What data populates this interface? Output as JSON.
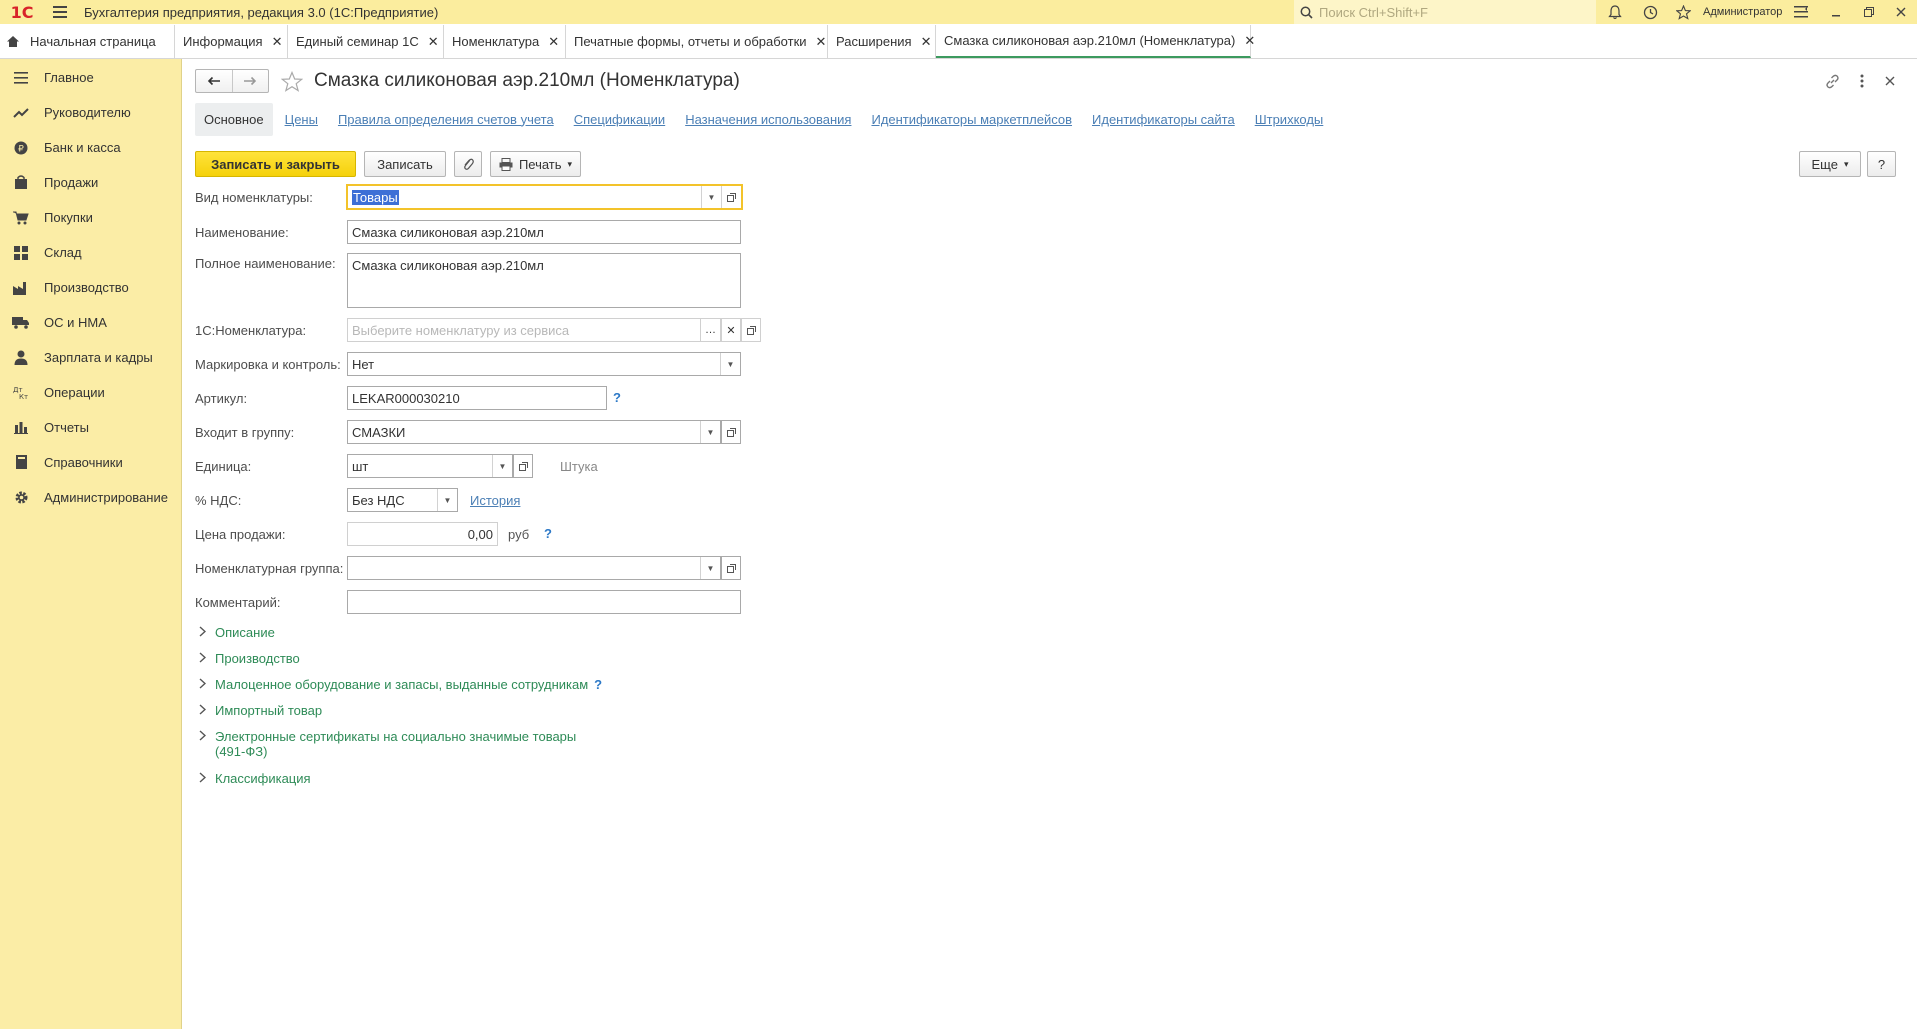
{
  "app": {
    "logo": "1С",
    "title": "Бухгалтерия предприятия, редакция 3.0  (1С:Предприятие)",
    "search_placeholder": "Поиск Ctrl+Shift+F",
    "user": "Администратор"
  },
  "tabs": [
    {
      "label": "Начальная страница"
    },
    {
      "label": "Информация"
    },
    {
      "label": "Единый семинар 1С"
    },
    {
      "label": "Номенклатура"
    },
    {
      "label": "Печатные формы, отчеты и обработки"
    },
    {
      "label": "Расширения"
    },
    {
      "label": "Смазка силиконовая аэр.210мл (Номенклатура)"
    }
  ],
  "sidebar": {
    "items": [
      {
        "label": "Главное",
        "icon": "menu-icon"
      },
      {
        "label": "Руководителю",
        "icon": "trend-icon"
      },
      {
        "label": "Банк и касса",
        "icon": "coin-icon"
      },
      {
        "label": "Продажи",
        "icon": "bag-icon"
      },
      {
        "label": "Покупки",
        "icon": "cart-icon"
      },
      {
        "label": "Склад",
        "icon": "grid-icon"
      },
      {
        "label": "Производство",
        "icon": "factory-icon"
      },
      {
        "label": "ОС и НМА",
        "icon": "truck-icon"
      },
      {
        "label": "Зарплата и кадры",
        "icon": "person-icon"
      },
      {
        "label": "Операции",
        "icon": "dtkt-icon"
      },
      {
        "label": "Отчеты",
        "icon": "bar-chart-icon"
      },
      {
        "label": "Справочники",
        "icon": "book-icon"
      },
      {
        "label": "Администрирование",
        "icon": "gear-icon"
      }
    ]
  },
  "form": {
    "title": "Смазка силиконовая аэр.210мл (Номенклатура)",
    "subtabs": [
      {
        "label": "Основное"
      },
      {
        "label": "Цены"
      },
      {
        "label": "Правила определения счетов учета"
      },
      {
        "label": "Спецификации"
      },
      {
        "label": "Назначения использования"
      },
      {
        "label": "Идентификаторы маркетплейсов"
      },
      {
        "label": "Идентификаторы сайта"
      },
      {
        "label": "Штрихкоды"
      }
    ],
    "toolbar": {
      "save_close": "Записать и закрыть",
      "save": "Записать",
      "print": "Печать",
      "more": "Еще",
      "help": "?"
    },
    "fields": {
      "kind": {
        "label": "Вид номенклатуры:",
        "value": "Товары"
      },
      "name": {
        "label": "Наименование:",
        "value": "Смазка силиконовая аэр.210мл"
      },
      "full_name": {
        "label": "Полное наименование:",
        "value": "Смазка силиконовая аэр.210мл"
      },
      "onec_nom": {
        "label": "1С:Номенклатура:",
        "placeholder": "Выберите номенклатуру из сервиса"
      },
      "marking": {
        "label": "Маркировка и контроль:",
        "value": "Нет"
      },
      "article": {
        "label": "Артикул:",
        "value": "LEKAR000030210"
      },
      "group": {
        "label": "Входит в группу:",
        "value": "СМАЗКИ"
      },
      "unit": {
        "label": "Единица:",
        "value": "шт",
        "hint": "Штука"
      },
      "vat": {
        "label": "% НДС:",
        "value": "Без НДС",
        "link": "История"
      },
      "price": {
        "label": "Цена продажи:",
        "value": "0,00",
        "currency": "руб"
      },
      "nom_group": {
        "label": "Номенклатурная группа:",
        "value": ""
      },
      "comment": {
        "label": "Комментарий:",
        "value": ""
      }
    },
    "groups": [
      {
        "label": "Описание"
      },
      {
        "label": "Производство"
      },
      {
        "label": "Малоценное оборудование и запасы, выданные сотрудникам"
      },
      {
        "label": "Импортный товар"
      },
      {
        "label": "Электронные сертификаты на социально значимые товары",
        "label2": "(491-ФЗ)"
      },
      {
        "label": "Классификация"
      }
    ]
  },
  "colors": {
    "header_bg": "#FBED9E",
    "sidebar_bg": "#FBEDA6",
    "primary_button": "#F5D10B",
    "link": "#4B7FB5",
    "group_green": "#2E8B57"
  }
}
